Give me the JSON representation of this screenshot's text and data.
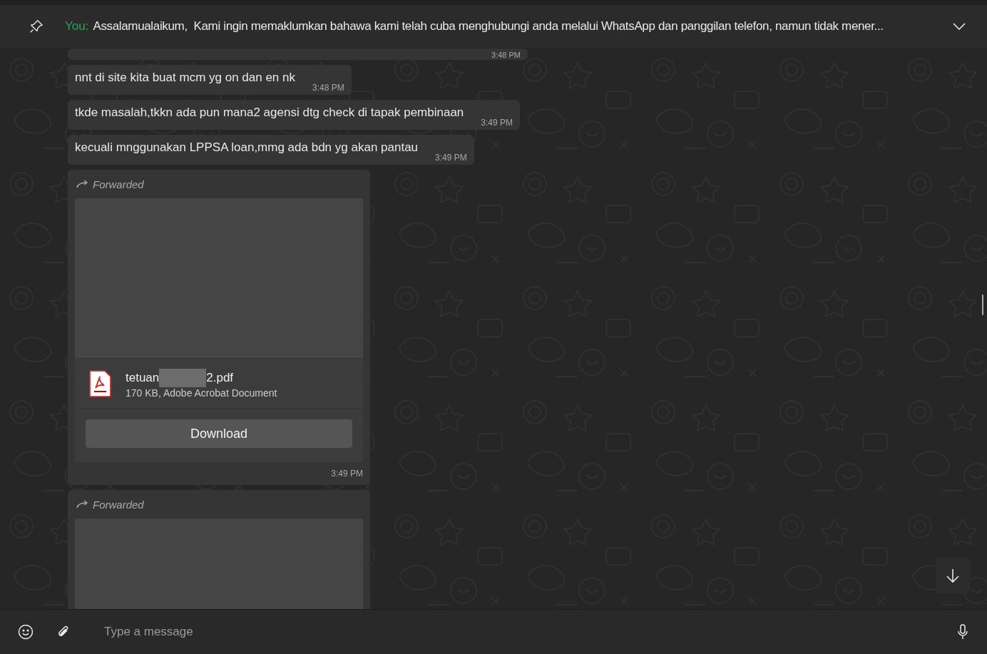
{
  "pinned": {
    "sender": "You:",
    "text": "Assalamualaikum,  Kami ingin memaklumkan bahawa kami telah cuba menghubungi anda melalui WhatsApp dan panggilan telefon, namun tidak mener..."
  },
  "messages": [
    {
      "kind": "stub",
      "time": "3:48 PM"
    },
    {
      "kind": "text",
      "text": "nnt di site kita buat mcm yg on dan en nk",
      "time": "3:48 PM"
    },
    {
      "kind": "text",
      "text": "tkde masalah,tkkn ada pun mana2 agensi dtg check di tapak pembinaan",
      "time": "3:49 PM"
    },
    {
      "kind": "text",
      "text": "kecuali mnggunakan LPPSA loan,mmg ada bdn yg akan pantau",
      "time": "3:49 PM"
    },
    {
      "kind": "file",
      "forwarded": "Forwarded",
      "name_start": "tetuan",
      "name_end": "2.pdf",
      "details": "170 KB, Adobe Acrobat Document",
      "button": "Download",
      "time": "3:49 PM"
    },
    {
      "kind": "file_partial",
      "forwarded": "Forwarded"
    }
  ],
  "composer": {
    "placeholder": "Type a message"
  }
}
